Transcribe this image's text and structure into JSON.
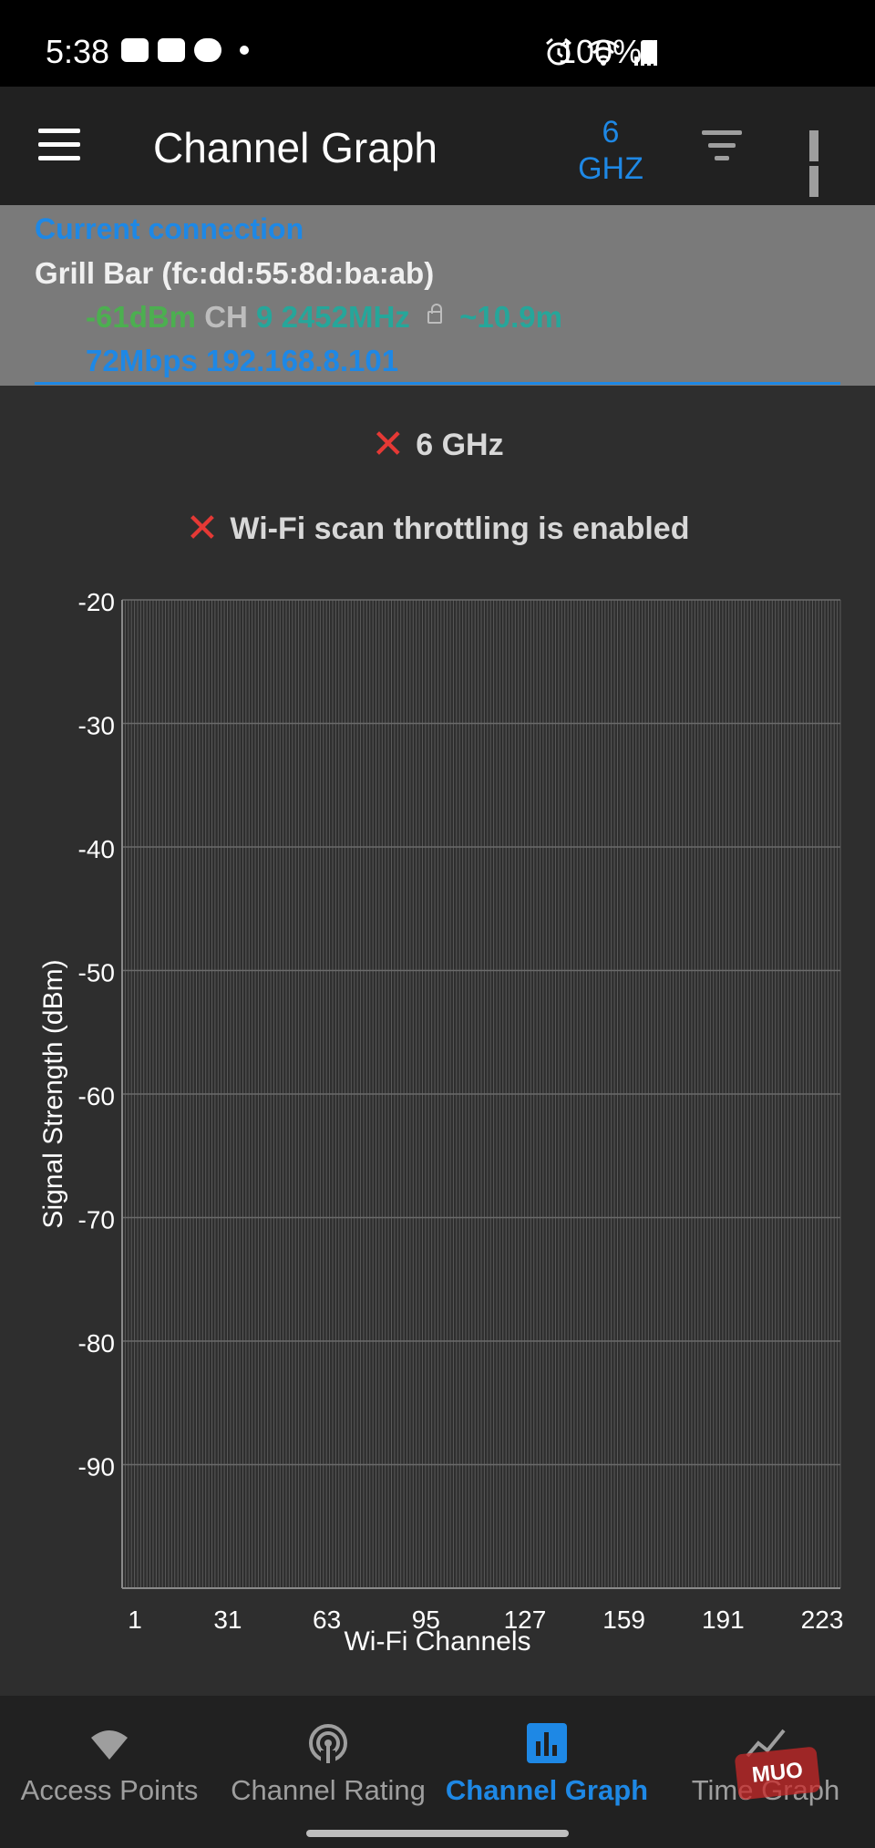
{
  "status_bar": {
    "time": "5:38",
    "battery": "100%"
  },
  "app_bar": {
    "title": "Channel Graph",
    "band_number": "6",
    "band_unit": "GHZ"
  },
  "connection": {
    "header": "Current connection",
    "ssid": "Grill Bar (fc:dd:55:8d:ba:ab)",
    "signal": "-61dBm",
    "channel_label": "CH",
    "channel": "9",
    "frequency": "2452MHz",
    "distance": "~10.9m",
    "link_info": "72Mbps 192.168.8.101"
  },
  "warnings": {
    "band": "6 GHz",
    "throttling": "Wi-Fi scan throttling is enabled"
  },
  "chart_data": {
    "type": "line",
    "xlabel": "Wi-Fi Channels",
    "ylabel": "Signal Strength (dBm)",
    "ylim": [
      -100,
      -20
    ],
    "y_ticks": [
      -20,
      -30,
      -40,
      -50,
      -60,
      -70,
      -80,
      -90
    ],
    "x_tick_labels": [
      "1",
      "31",
      "63",
      "95",
      "127",
      "159",
      "191",
      "223"
    ],
    "xlim": [
      1,
      233
    ],
    "grid": true,
    "series": []
  },
  "bottom_nav": {
    "items": [
      {
        "label": "Access Points",
        "icon": "wifi-icon"
      },
      {
        "label": "Channel Rating",
        "icon": "antenna-icon"
      },
      {
        "label": "Channel Graph",
        "icon": "bar-chart-icon"
      },
      {
        "label": "Time Graph",
        "icon": "line-chart-icon"
      }
    ],
    "active_index": 2,
    "watermark": "MUO"
  },
  "colors": {
    "accent": "#1e88e5",
    "signal_green": "#4caf50",
    "teal": "#26a69a",
    "error_red": "#e53935"
  }
}
